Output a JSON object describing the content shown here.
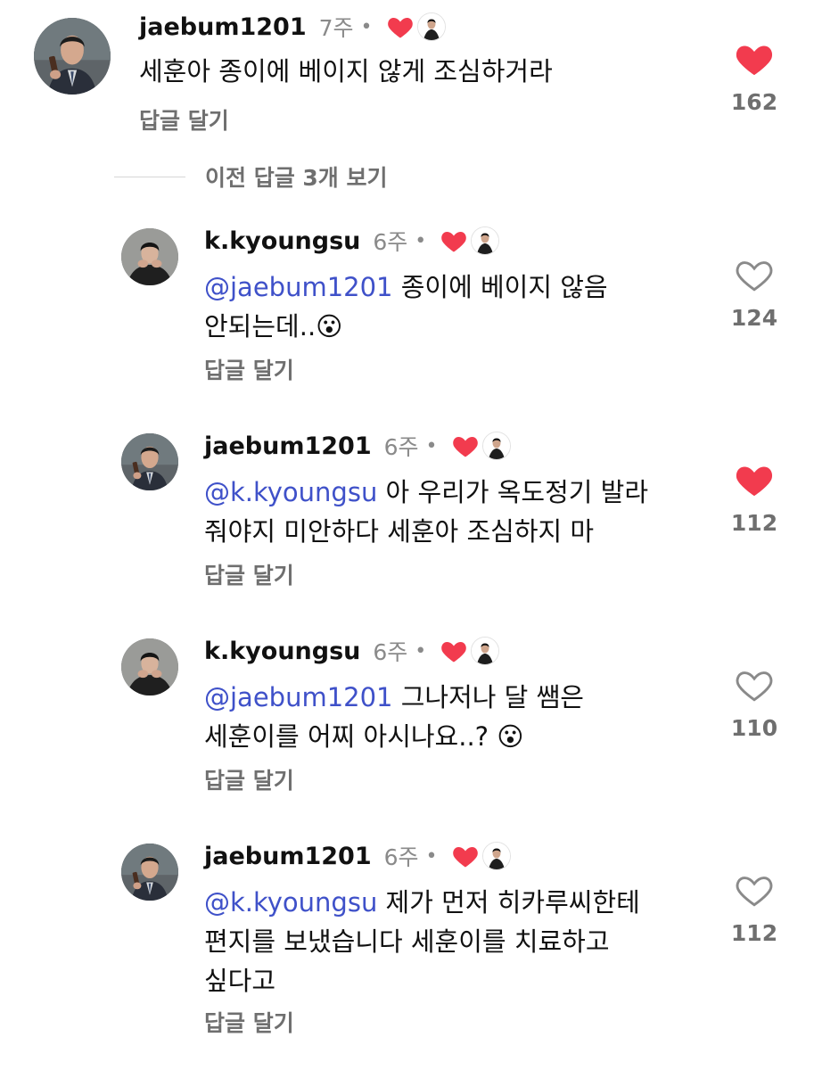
{
  "comments": [
    {
      "username": "jaebum1201",
      "time": "7주",
      "dot": "•",
      "text_parts": [
        {
          "t": "세훈아 종이에 베이지 않게 조심하거라",
          "mention": false
        }
      ],
      "text_lines": [
        "세훈아 종이에 베이지 않게 조심하거라"
      ],
      "reply_label": "답글 달기",
      "likes": "162",
      "liked": true,
      "avatar": "jaebum-avatar"
    },
    {
      "username": "k.kyoungsu",
      "time": "6주",
      "dot": "•",
      "mention": "@jaebum1201",
      "line1_rest": " 종이에 베이지 않음",
      "line2": "안되는데..",
      "emoji": "😮",
      "reply_label": "답글 달기",
      "likes": "124",
      "liked": false,
      "avatar": "kyoungsu-avatar"
    },
    {
      "username": "jaebum1201",
      "time": "6주",
      "dot": "•",
      "mention": "@k.kyoungsu",
      "line1_rest": " 아 우리가 옥도정기 발라",
      "line2": "줘야지 미안하다 세훈아 조심하지 마",
      "reply_label": "답글 달기",
      "likes": "112",
      "liked": true,
      "avatar": "jaebum-avatar"
    },
    {
      "username": "k.kyoungsu",
      "time": "6주",
      "dot": "•",
      "mention": "@jaebum1201",
      "line1_rest": " 그나저나 달 쌤은",
      "line2": "세훈이를 어찌 아시나요..? ",
      "emoji": "😮",
      "reply_label": "답글 달기",
      "likes": "110",
      "liked": false,
      "avatar": "kyoungsu-avatar"
    },
    {
      "username": "jaebum1201",
      "time": "6주",
      "dot": "•",
      "mention": "@k.kyoungsu",
      "line1_rest": " 제가 먼저 히카루씨한테",
      "line2": "편지를 보냈습니다  세훈이를 치료하고",
      "line3": "싶다고",
      "reply_label": "답글 달기",
      "likes": "112",
      "liked": false,
      "avatar": "jaebum-avatar"
    }
  ],
  "prev_replies_label": "이전 답글 3개 보기",
  "colors": {
    "heart": "#f23b4e",
    "mention": "#3f51c9",
    "muted": "#8a8a8a"
  },
  "icons": [
    "heart-filled-icon",
    "heart-outline-icon",
    "creator-avatar-icon"
  ]
}
